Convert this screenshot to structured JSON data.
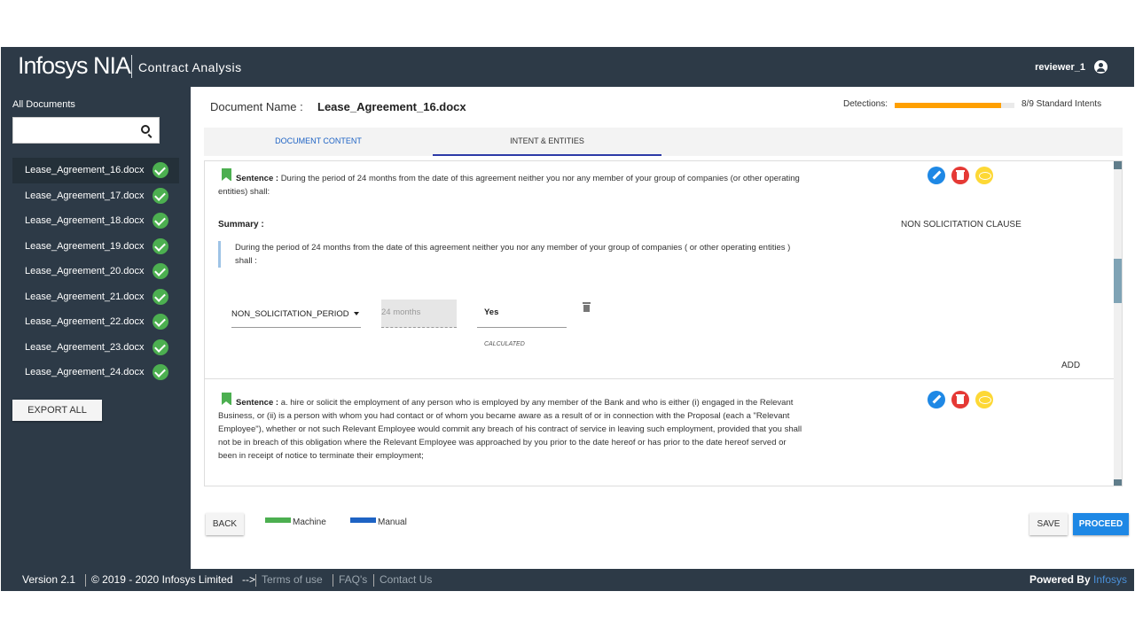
{
  "header": {
    "logo": "Infosys NIA",
    "app_title": "Contract Analysis",
    "user": "reviewer_1",
    "user_icon": "account-circle-icon"
  },
  "sidebar": {
    "title": "All Documents",
    "search_placeholder": "",
    "items": [
      {
        "label": "Lease_Agreement_16.docx",
        "status": "done"
      },
      {
        "label": "Lease_Agreement_17.docx",
        "status": "done"
      },
      {
        "label": "Lease_Agreement_18.docx",
        "status": "done"
      },
      {
        "label": "Lease_Agreement_19.docx",
        "status": "done"
      },
      {
        "label": "Lease_Agreement_20.docx",
        "status": "done"
      },
      {
        "label": "Lease_Agreement_21.docx",
        "status": "done"
      },
      {
        "label": "Lease_Agreement_22.docx",
        "status": "done"
      },
      {
        "label": "Lease_Agreement_23.docx",
        "status": "done"
      },
      {
        "label": "Lease_Agreement_24.docx",
        "status": "done"
      }
    ],
    "export_label": "EXPORT ALL"
  },
  "main": {
    "doc_name_label": "Document Name :",
    "doc_name": "Lease_Agreement_16.docx",
    "detections_label": "Detections:",
    "detections_fraction": 0.89,
    "detections_text": "8/9 Standard Intents",
    "tabs": [
      {
        "label": "DOCUMENT CONTENT",
        "active": false
      },
      {
        "label": "INTENT & ENTITIES",
        "active": true
      }
    ],
    "cards": [
      {
        "sentence_label": "Sentence :",
        "sentence": "During the period of 24 months from the date of this agreement neither you nor any member of your group of companies (or other operating entities) shall:",
        "summary_label": "Summary :",
        "clause": "NON SOLICITATION CLAUSE",
        "summary_text": "During the period of 24 months from the date of this agreement neither you nor any member of your group of companies ( or other operating entities ) shall :",
        "entity_name": "NON_SOLICITATION_PERIOD",
        "entity_value": "24 months",
        "entity_answer": "Yes",
        "calculated_label": "CALCULATED",
        "add_label": "ADD"
      },
      {
        "sentence_label": "Sentence :",
        "sentence": "a. hire or solicit the employment of any person who is employed by any member of the Bank and who is either (i) engaged in the Relevant Business, or (ii) is a person with whom you had contact or of whom you became aware as a result of or in connection with the Proposal (each a \"Relevant Employee\"), whether or not such Relevant Employee would commit any breach of his contract of service in leaving such employment, provided that you shall not be in breach of this obligation where the Relevant Employee was approached by you prior to the date hereof or has prior to the date hereof served or been in receipt of notice to terminate their employment;"
      }
    ],
    "legend": [
      {
        "label": "Machine",
        "color": "#4caf50"
      },
      {
        "label": "Manual",
        "color": "#1e63c4"
      }
    ],
    "back_label": "BACK",
    "save_label": "SAVE",
    "proceed_label": "PROCEED"
  },
  "footer": {
    "version": "Version 2.1",
    "copyright": "© 2019 - 2020 Infosys Limited",
    "arrow": "-->",
    "terms": "Terms of use",
    "faq": "FAQ's",
    "contact": "Contact Us",
    "powered_label": "Powered By",
    "powered_brand": "Infosys"
  }
}
